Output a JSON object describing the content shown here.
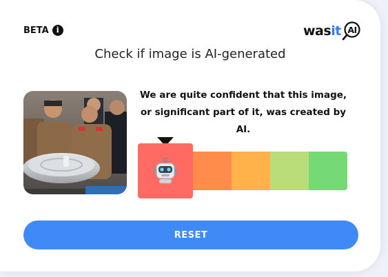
{
  "header": {
    "beta_label": "BETA",
    "info_icon_glyph": "i",
    "logo": {
      "part1": "was",
      "part2": "it",
      "part3": "AI",
      "accent_color": "#2f7cf6"
    }
  },
  "main": {
    "title": "Check if image is AI-generated",
    "result_message": "We are quite confident that this image, or significant part of it, was created by AI.",
    "image": {
      "icon": "uploaded-photo-thumbnail"
    },
    "meter": {
      "selected_level": 1,
      "levels": 5,
      "selected_icon": "robot-icon",
      "colors": [
        "#ff6a63",
        "#ff8c4b",
        "#ffb24a",
        "#badc79",
        "#75da75"
      ]
    }
  },
  "actions": {
    "reset_label": "RESET",
    "button_color": "#3f8af7"
  }
}
